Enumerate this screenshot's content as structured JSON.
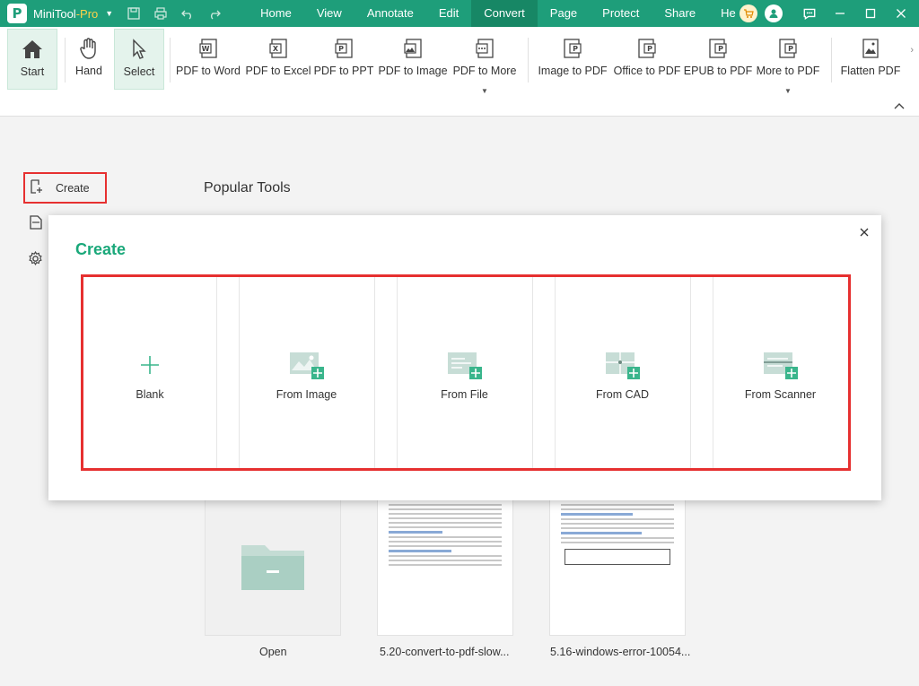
{
  "app": {
    "name": "MiniTool",
    "edition": "-Pro"
  },
  "menu": [
    "Home",
    "View",
    "Annotate",
    "Edit",
    "Convert",
    "Page",
    "Protect",
    "Share",
    "He"
  ],
  "active_menu": "Convert",
  "ribbon": {
    "start": "Start",
    "hand": "Hand",
    "select": "Select",
    "pdf_to_word": "PDF to Word",
    "pdf_to_excel": "PDF to Excel",
    "pdf_to_ppt": "PDF to PPT",
    "pdf_to_image": "PDF to Image",
    "pdf_to_more": "PDF to More",
    "image_to_pdf": "Image to PDF",
    "office_to_pdf": "Office to PDF",
    "epub_to_pdf": "EPUB to PDF",
    "more_to_pdf": "More to PDF",
    "flatten_pdf": "Flatten PDF"
  },
  "sidebar": {
    "create": "Create"
  },
  "main": {
    "popular_tools": "Popular Tools",
    "recent": [
      "Open",
      "5.20-convert-to-pdf-slow...",
      "5.16-windows-error-10054..."
    ]
  },
  "modal": {
    "title": "Create",
    "tiles": [
      "Blank",
      "From Image",
      "From File",
      "From CAD",
      "From Scanner"
    ]
  },
  "colors": {
    "brand": "#1e9e7a",
    "accent": "#1aa87a",
    "highlight": "#e63030"
  }
}
